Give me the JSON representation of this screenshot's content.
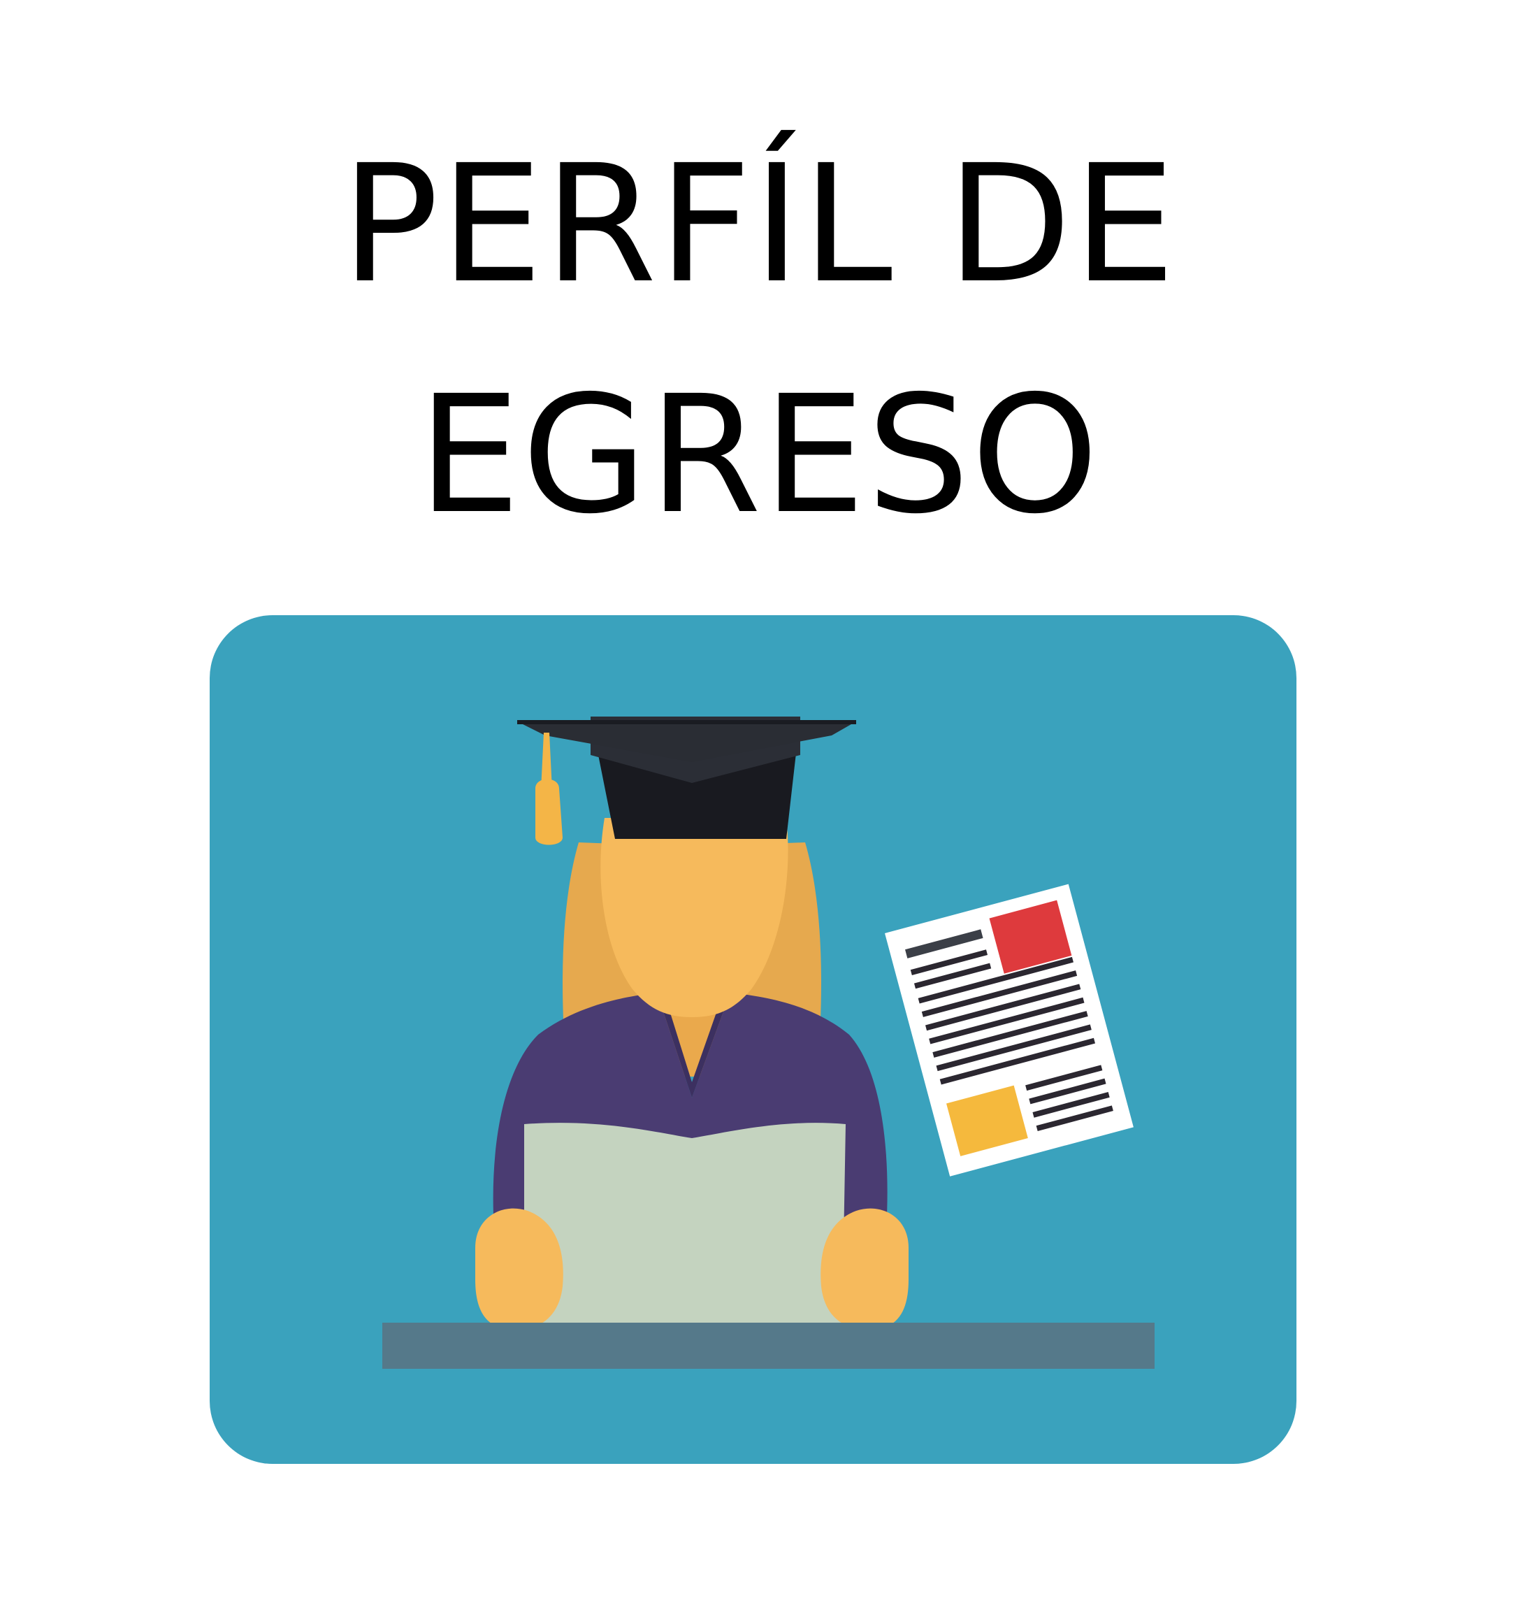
{
  "title": {
    "line1": "PERFÍL DE",
    "line2": "EGRESO"
  },
  "illustration": {
    "subject": "graduate-reading-document",
    "icons": [
      "graduation-cap-icon",
      "document-icon"
    ],
    "colors": {
      "background": "#3aa2bd",
      "cap": "#24272e",
      "tassel": "#f4b547",
      "skin": "#f6ba5c",
      "hair": "#e6a94e",
      "gown": "#4a3c72",
      "paper": "#c4d3bf",
      "desk": "#55798a",
      "doc_red": "#de3a3d",
      "doc_yellow": "#f5b93d"
    }
  }
}
